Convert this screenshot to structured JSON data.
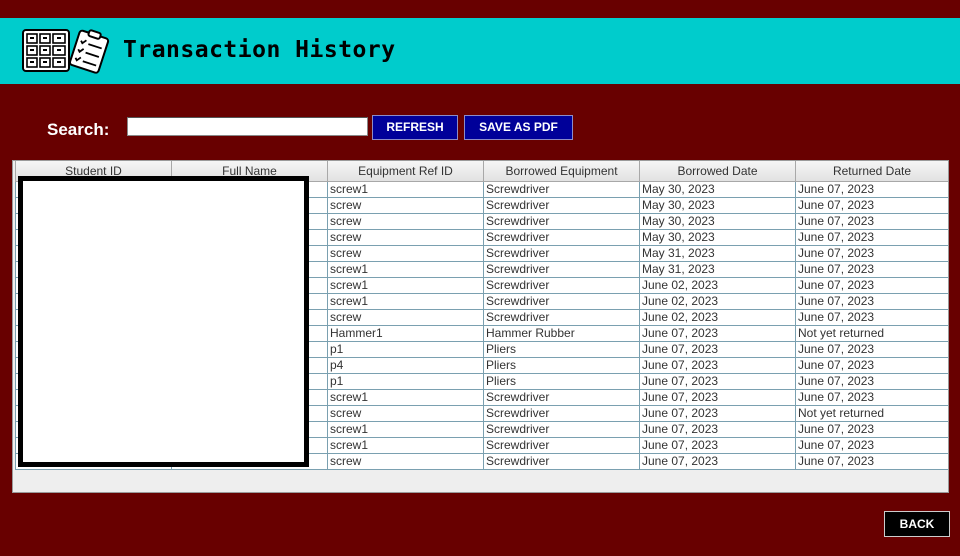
{
  "header": {
    "title": "Transaction History",
    "logo_icon": "inventory-checklist-logo-icon",
    "background": "#00cccc"
  },
  "search": {
    "label": "Search:",
    "value": "",
    "placeholder": ""
  },
  "toolbar": {
    "refresh_label": "REFRESH",
    "save_pdf_label": "SAVE AS PDF",
    "button_color": "#000099"
  },
  "table": {
    "columns": [
      "Student ID",
      "Full Name",
      "Equipment Ref ID",
      "Borrowed Equipment",
      "Borrowed Date",
      "Returned Date"
    ],
    "rows": [
      [
        "",
        "",
        "screw1",
        "Screwdriver",
        "May 30, 2023",
        "June 07, 2023"
      ],
      [
        "",
        "",
        "screw",
        "Screwdriver",
        "May 30, 2023",
        "June 07, 2023"
      ],
      [
        "",
        "",
        "screw",
        "Screwdriver",
        "May 30, 2023",
        "June 07, 2023"
      ],
      [
        "",
        "",
        "screw",
        "Screwdriver",
        "May 30, 2023",
        "June 07, 2023"
      ],
      [
        "",
        "",
        "screw",
        "Screwdriver",
        "May 31, 2023",
        "June 07, 2023"
      ],
      [
        "",
        "",
        "screw1",
        "Screwdriver",
        "May 31, 2023",
        "June 07, 2023"
      ],
      [
        "",
        "",
        "screw1",
        "Screwdriver",
        "June 02, 2023",
        "June 07, 2023"
      ],
      [
        "",
        "",
        "screw1",
        "Screwdriver",
        "June 02, 2023",
        "June 07, 2023"
      ],
      [
        "",
        "",
        "screw",
        "Screwdriver",
        "June 02, 2023",
        "June 07, 2023"
      ],
      [
        "",
        "",
        "Hammer1",
        "Hammer Rubber",
        "June 07, 2023",
        "Not yet returned"
      ],
      [
        "",
        "",
        "p1",
        "Pliers",
        "June 07, 2023",
        "June 07, 2023"
      ],
      [
        "",
        "",
        "p4",
        "Pliers",
        "June 07, 2023",
        "June 07, 2023"
      ],
      [
        "",
        "",
        "p1",
        "Pliers",
        "June 07, 2023",
        "June 07, 2023"
      ],
      [
        "",
        "",
        "screw1",
        "Screwdriver",
        "June 07, 2023",
        "June 07, 2023"
      ],
      [
        "",
        "",
        "screw",
        "Screwdriver",
        "June 07, 2023",
        "Not yet returned"
      ],
      [
        "",
        "",
        "screw1",
        "Screwdriver",
        "June 07, 2023",
        "June 07, 2023"
      ],
      [
        "",
        "",
        "screw1",
        "Screwdriver",
        "June 07, 2023",
        "June 07, 2023"
      ],
      [
        "",
        "",
        "screw",
        "Screwdriver",
        "June 07, 2023",
        "June 07, 2023"
      ]
    ]
  },
  "footer": {
    "back_label": "BACK"
  },
  "colors": {
    "page_background": "#680000",
    "grid_line": "#7aa0b0"
  }
}
